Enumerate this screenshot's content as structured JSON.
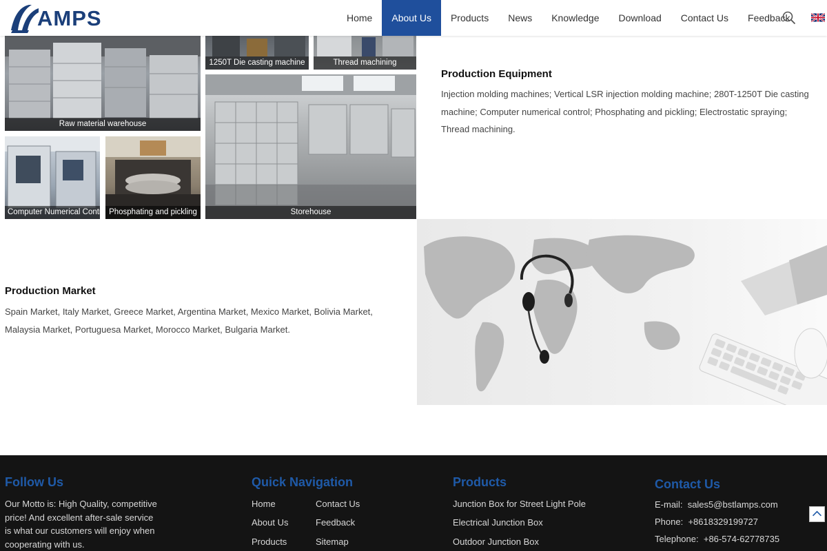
{
  "header": {
    "logo_text": "AMPS",
    "nav": [
      {
        "label": "Home"
      },
      {
        "label": "About Us",
        "active": true
      },
      {
        "label": "Products"
      },
      {
        "label": "News"
      },
      {
        "label": "Knowledge"
      },
      {
        "label": "Download"
      },
      {
        "label": "Contact Us"
      },
      {
        "label": "Feedback"
      }
    ],
    "search_icon": "search-icon",
    "language_icon": "uk-flag-icon"
  },
  "gallery": {
    "warehouse_caption": "Raw material warehouse",
    "diecast_caption": "1250T Die casting machine",
    "thread_caption": "Thread machining",
    "cnc_caption": "Computer Numerical Control",
    "phosphating_caption": "Phosphating and pickling",
    "storehouse_caption": "Storehouse"
  },
  "equipment": {
    "title": "Production Equipment",
    "body": "Injection molding machines; Vertical LSR injection molding machine; 280T-1250T Die casting machine; Computer numerical control; Phosphating and pickling; Electrostatic spraying; Thread machining."
  },
  "market": {
    "title": "Production Market",
    "body": "Spain Market, Italy Market, Greece Market, Argentina Market, Mexico Market, Bolivia Market, Malaysia Market, Portuguesa Market, Morocco Market, Bulgaria Market."
  },
  "footer": {
    "follow": {
      "title": "Follow Us",
      "motto": "Our Motto is: High Quality, competitive price! And excellent after-sale service is what our customers will enjoy when cooperating with us."
    },
    "quick_nav": {
      "title": "Quick Navigation",
      "links_col1": [
        "Home",
        "About Us",
        "Products"
      ],
      "links_col2": [
        "Contact Us",
        "Feedback",
        "Sitemap"
      ]
    },
    "products": {
      "title": "Products",
      "links": [
        "Junction Box for Street Light Pole",
        "Electrical Junction Box",
        "Outdoor Junction Box"
      ]
    },
    "contact": {
      "title": "Contact Us",
      "email_label": "E-mail:",
      "email": "sales5@bstlamps.com",
      "phone_label": "Phone:",
      "phone": "+8618329199727",
      "tel_label": "Telephone:",
      "tel": "+86-574-62778735"
    }
  },
  "colors": {
    "brand": "#1b3f7a",
    "nav_active": "#1f4f9c",
    "footer_bg": "#141414",
    "footer_heading": "#1f5aa8"
  }
}
